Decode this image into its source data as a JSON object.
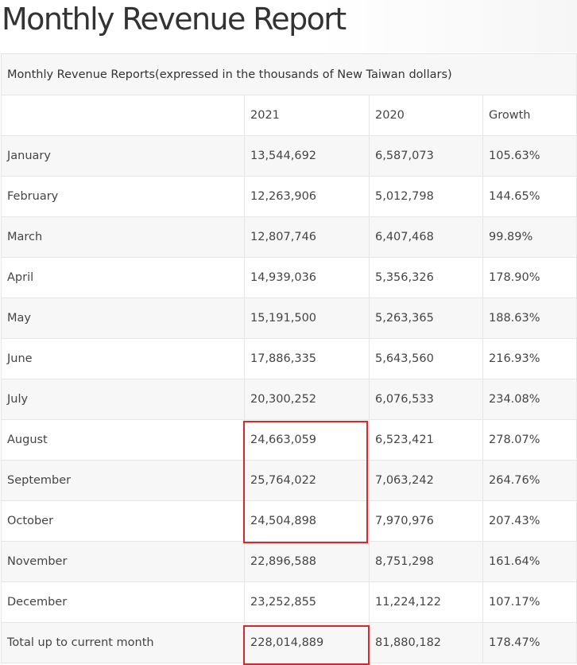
{
  "page": {
    "title": "Monthly Revenue Report"
  },
  "table": {
    "caption": "Monthly Revenue Reports(expressed in the thousands of New Taiwan dollars)",
    "columns": [
      "",
      "2021",
      "2020",
      "Growth"
    ],
    "rows": [
      {
        "month": "January",
        "y2021": "13,544,692",
        "y2020": "6,587,073",
        "growth": "105.63%"
      },
      {
        "month": "February",
        "y2021": "12,263,906",
        "y2020": "5,012,798",
        "growth": "144.65%"
      },
      {
        "month": "March",
        "y2021": "12,807,746",
        "y2020": "6,407,468",
        "growth": "99.89%"
      },
      {
        "month": "April",
        "y2021": "14,939,036",
        "y2020": "5,356,326",
        "growth": "178.90%"
      },
      {
        "month": "May",
        "y2021": "15,191,500",
        "y2020": "5,263,365",
        "growth": "188.63%"
      },
      {
        "month": "June",
        "y2021": "17,886,335",
        "y2020": "5,643,560",
        "growth": "216.93%"
      },
      {
        "month": "July",
        "y2021": "20,300,252",
        "y2020": "6,076,533",
        "growth": "234.08%"
      },
      {
        "month": "August",
        "y2021": "24,663,059",
        "y2020": "6,523,421",
        "growth": "278.07%"
      },
      {
        "month": "September",
        "y2021": "25,764,022",
        "y2020": "7,063,242",
        "growth": "264.76%"
      },
      {
        "month": "October",
        "y2021": "24,504,898",
        "y2020": "7,970,976",
        "growth": "207.43%"
      },
      {
        "month": "November",
        "y2021": "22,896,588",
        "y2020": "8,751,298",
        "growth": "161.64%"
      },
      {
        "month": "December",
        "y2021": "23,252,855",
        "y2020": "11,224,122",
        "growth": "107.17%"
      }
    ],
    "total": {
      "label": "Total up to current month",
      "y2021": "228,014,889",
      "y2020": "81,880,182",
      "growth": "178.47%"
    }
  },
  "annotations": {
    "highlight_color": "#d9272e",
    "highlights": [
      {
        "name": "aug-oct-2021-highlight",
        "column": "2021",
        "rows": [
          "August",
          "September",
          "October"
        ]
      },
      {
        "name": "total-2021-highlight",
        "column": "2021",
        "rows": [
          "Total up to current month"
        ]
      }
    ]
  }
}
